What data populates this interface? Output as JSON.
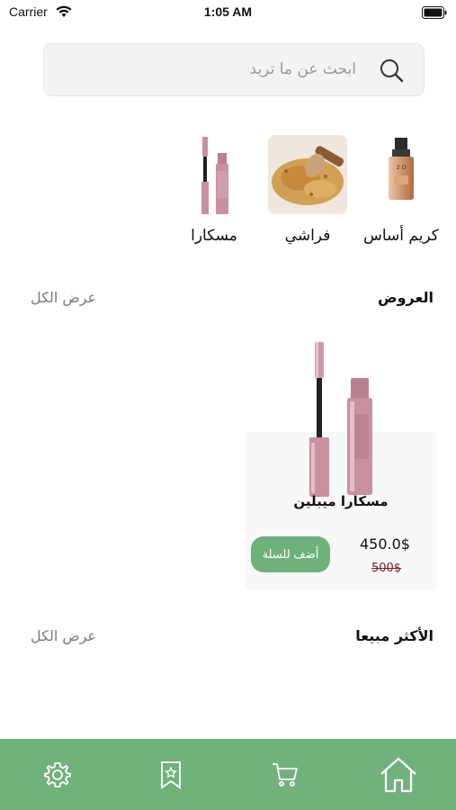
{
  "status": {
    "carrier": "Carrier",
    "time": "1:05 AM"
  },
  "search": {
    "placeholder": "ابحث عن ما تريد"
  },
  "categories": [
    {
      "label": "كريم أساس",
      "icon": "foundation-bottle"
    },
    {
      "label": "فراشي",
      "icon": "brush-powder"
    },
    {
      "label": "مسكارا",
      "icon": "mascara"
    }
  ],
  "offers": {
    "title": "العروض",
    "see_all": "عرض الكل",
    "products": [
      {
        "name": "مسكارا ميبلين",
        "price": "450.0$",
        "old_price": "500$",
        "add_label": "أضف للسلة"
      }
    ]
  },
  "best_sellers": {
    "title": "الأكثر مبيعا",
    "see_all": "عرض الكل"
  },
  "tabs": [
    {
      "icon": "settings-icon"
    },
    {
      "icon": "bookmark-icon"
    },
    {
      "icon": "cart-icon"
    },
    {
      "icon": "home-icon"
    }
  ],
  "colors": {
    "accent": "#71b27c",
    "mascara": "#c9909e"
  }
}
